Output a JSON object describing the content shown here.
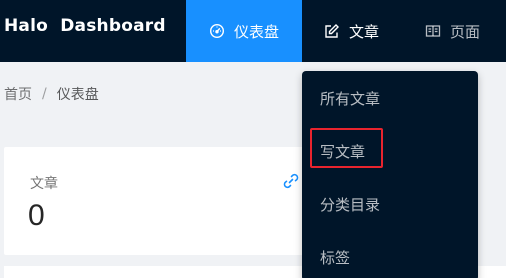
{
  "header": {
    "brand": "Halo  Dashboard",
    "nav": [
      {
        "label": "仪表盘",
        "icon": "dashboard-icon",
        "active": true
      },
      {
        "label": "文章",
        "icon": "form-icon",
        "active": false
      },
      {
        "label": "页面",
        "icon": "read-icon",
        "active": false
      }
    ]
  },
  "breadcrumb": {
    "home": "首页",
    "separator": "/",
    "current": "仪表盘"
  },
  "card": {
    "label": "文章",
    "value": "0",
    "icon": "link-icon"
  },
  "dropdown": {
    "items": [
      {
        "label": "所有文章"
      },
      {
        "label": "写文章",
        "highlighted": true
      },
      {
        "label": "分类目录"
      },
      {
        "label": "标签"
      }
    ]
  },
  "colors": {
    "header_bg": "#001529",
    "active_nav": "#1890ff",
    "highlight_border": "#e8242e",
    "page_bg": "#f0f2f5"
  }
}
